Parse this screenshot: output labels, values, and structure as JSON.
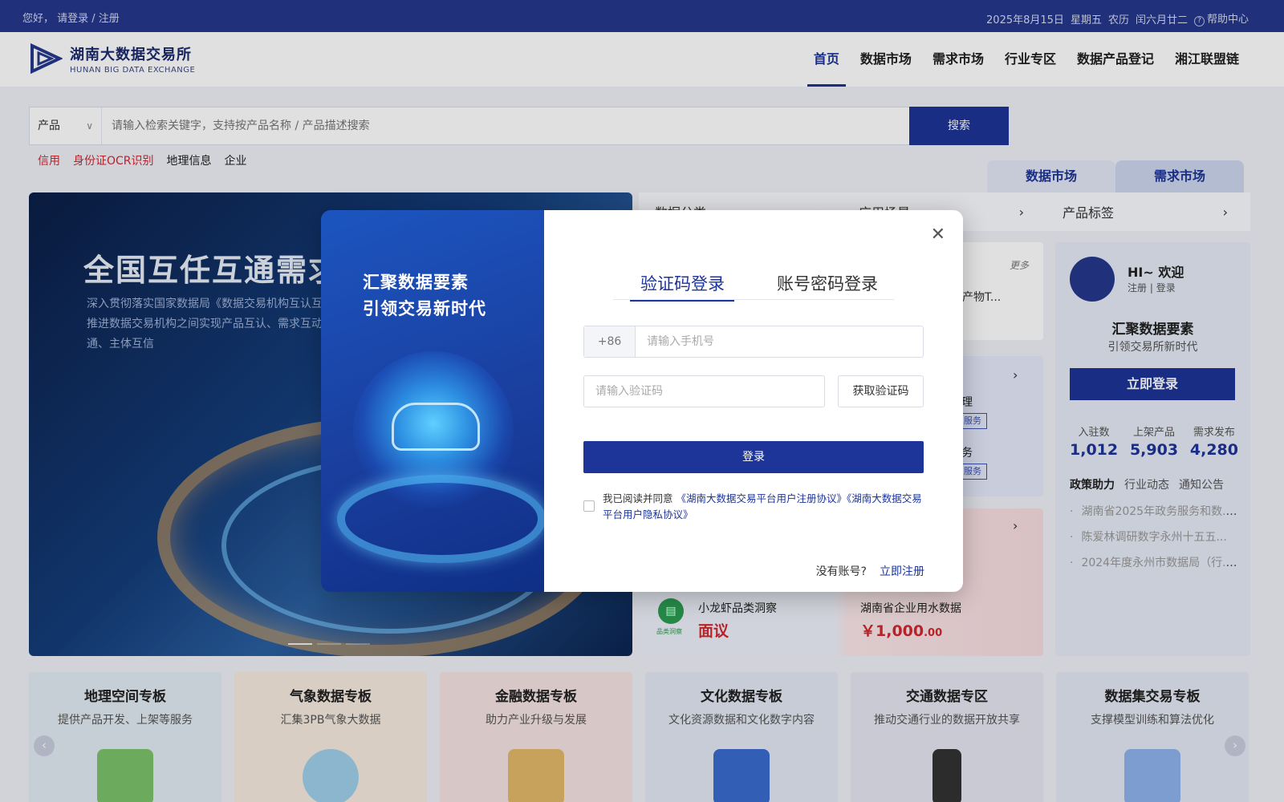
{
  "topbar": {
    "greeting": "您好， 请登录 / 注册",
    "date": "2025年8月15日",
    "weekday": "星期五",
    "lunar": "农历",
    "lunar_date": "闰六月廿二",
    "help": "帮助中心"
  },
  "logo": {
    "cn": "湖南大数据交易所",
    "en": "HUNAN BIG DATA EXCHANGE"
  },
  "nav": {
    "items": [
      "首页",
      "数据市场",
      "需求市场",
      "行业专区",
      "数据产品登记",
      "湘江联盟链"
    ],
    "active": "首页"
  },
  "search": {
    "category": "产品",
    "placeholder": "请输入检索关键字，支持按产品名称 / 产品描述搜索",
    "button": "搜索"
  },
  "hot_tags": [
    "信用",
    "身份证OCR识别",
    "地理信息",
    "企业"
  ],
  "banner": {
    "title": "全国互任互通需求",
    "desc": "深入贯彻落实国家数据局《数据交易机构互认互推进数据交易机构之间实现产品互认、需求互动通、主体互信"
  },
  "market_tabs": [
    "数据市场",
    "需求市场"
  ],
  "filters": [
    "数据分类",
    "应用场景",
    "产品标签"
  ],
  "card_a": {
    "more": "更多",
    "text": "产物T..."
  },
  "card_b": {
    "item1": "理",
    "item2": "务",
    "badge": "服务"
  },
  "card_c": {
    "icon_label": "品类洞察",
    "p1_name": "小龙虾品类洞察",
    "p1_price": "面议",
    "p2_name": "湖南省企业用水数据",
    "p2_price": "￥1,000",
    "p2_cents": ".00"
  },
  "sidebar": {
    "welcome": "HI~ 欢迎",
    "register": "注册",
    "login_small": "登录",
    "slogan": "汇聚数据要素",
    "slogan_sub": "引领交易所新时代",
    "login_button": "立即登录",
    "stats": [
      {
        "label": "入驻数",
        "value": "1,012"
      },
      {
        "label": "上架产品",
        "value": "5,903"
      },
      {
        "label": "需求发布",
        "value": "4,280"
      }
    ],
    "policy_tabs": [
      "政策助力",
      "行业动态",
      "通知公告"
    ],
    "news": [
      "湖南省2025年政务服务和数...",
      "陈爱林调研数字永州十五五...",
      "2024年度永州市数据局（行..."
    ]
  },
  "boards": [
    {
      "title": "地理空间专板",
      "desc": "提供产品开发、上架等服务",
      "bg": "#e3ecf4"
    },
    {
      "title": "气象数据专板",
      "desc": "汇集3PB气象大数据",
      "bg": "#f6ebe0"
    },
    {
      "title": "金融数据专板",
      "desc": "助力产业升级与发展",
      "bg": "#f6e3e3"
    },
    {
      "title": "文化数据专板",
      "desc": "文化资源数据和文化数字内容",
      "bg": "#e3e9f4"
    },
    {
      "title": "交通数据专区",
      "desc": "推动交通行业的数据开放共享",
      "bg": "#e6e6f3"
    },
    {
      "title": "数据集交易专板",
      "desc": "支撑模型训练和算法优化",
      "bg": "#e3e9f4"
    }
  ],
  "modal": {
    "left_line1": "汇聚数据要素",
    "left_line2": "引领交易新时代",
    "tabs": [
      "验证码登录",
      "账号密码登录"
    ],
    "country_code": "+86",
    "phone_placeholder": "请输入手机号",
    "code_placeholder": "请输入验证码",
    "get_code": "获取验证码",
    "login_button": "登录",
    "agree_text": "我已阅读并同意",
    "agreement1": "《湖南大数据交易平台用户注册协议》",
    "agreement2": "《湖南大数据交易平台用户隐私协议》",
    "no_account": "没有账号?",
    "register_now": "立即注册"
  }
}
